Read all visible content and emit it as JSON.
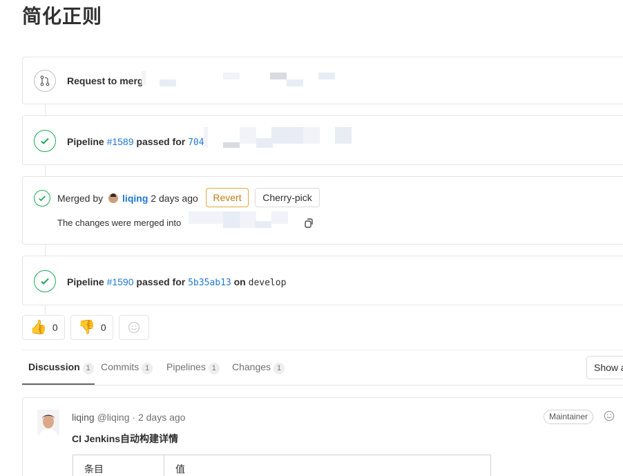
{
  "page": {
    "title": "简化正则"
  },
  "timeline": {
    "request": {
      "label": "Request to merg"
    },
    "pipeline1": {
      "prefix": "Pipeline",
      "id": "#1589",
      "middle": "passed for",
      "commit": "704"
    },
    "merged": {
      "prefix": "Merged by",
      "user": "liqing",
      "time": "2 days ago",
      "revert_label": "Revert",
      "cherry_pick_label": "Cherry-pick",
      "detail": "The changes were merged into"
    },
    "pipeline2": {
      "prefix": "Pipeline",
      "id": "#1590",
      "middle": "passed for",
      "commit": "5b35ab13",
      "on": "on",
      "branch": "develop"
    }
  },
  "awards": {
    "thumbsup_count": "0",
    "thumbsdown_count": "0"
  },
  "tabs": [
    {
      "label": "Discussion",
      "count": "1"
    },
    {
      "label": "Commits",
      "count": "1"
    },
    {
      "label": "Pipelines",
      "count": "1"
    },
    {
      "label": "Changes",
      "count": "1"
    }
  ],
  "show_all_label": "Show a",
  "note": {
    "author": "liqing",
    "handle": "@liqing",
    "separator": "·",
    "time": "2 days ago",
    "role": "Maintainer",
    "title": "CI Jenkins自动构建详情",
    "table_headers": [
      "条目",
      "值"
    ]
  },
  "colors": {
    "success": "#1aaa55",
    "link": "#1f78d1",
    "revert": "#e0a73a"
  },
  "icons": [
    "merge-request-icon",
    "check-circle-icon",
    "thumbs-up-icon",
    "thumbs-down-icon",
    "smiley-icon",
    "copy-icon"
  ]
}
